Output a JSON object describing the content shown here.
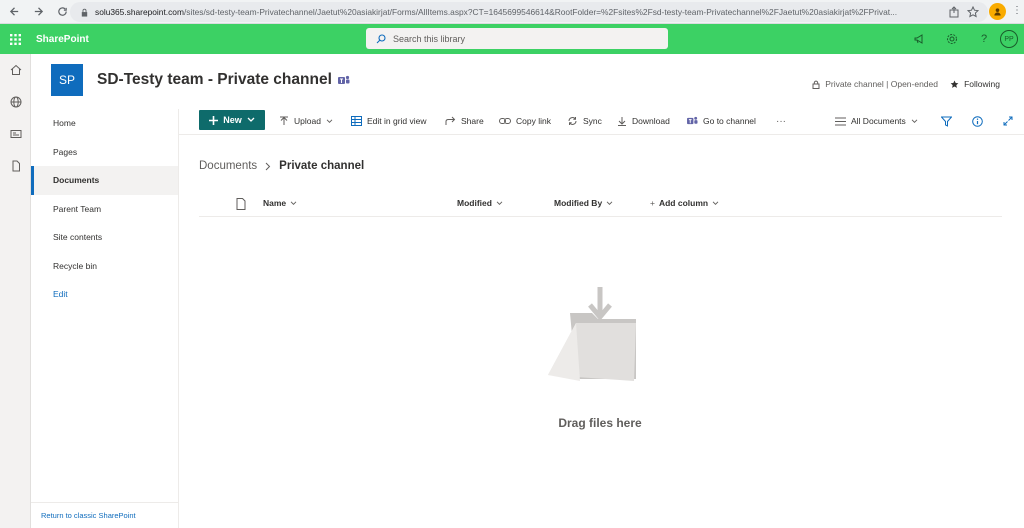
{
  "browser": {
    "url_host": "solu365.sharepoint.com",
    "url_path": "/sites/sd-testy-team-Privatechannel/Jaetut%20asiakirjat/Forms/AllItems.aspx?CT=1645699546614&RootFolder=%2Fsites%2Fsd-testy-team-Privatechannel%2FJaetut%20asiakirjat%2FPrivat..."
  },
  "suite": {
    "brand": "SharePoint",
    "search_placeholder": "Search this library",
    "avatar_initials": "PP",
    "color": "#3cd164"
  },
  "site": {
    "logo": "SP",
    "title": "SD-Testy team - Private channel",
    "meta": "Private channel | Open-ended",
    "following": "Following"
  },
  "nav": {
    "items": [
      "Home",
      "Pages",
      "Documents",
      "Parent Team",
      "Site contents",
      "Recycle bin"
    ],
    "selected": "Documents",
    "edit": "Edit",
    "classic": "Return to classic SharePoint"
  },
  "commands": {
    "new": "New",
    "upload": "Upload",
    "grid": "Edit in grid view",
    "share": "Share",
    "copy_link": "Copy link",
    "sync": "Sync",
    "download": "Download",
    "go_to_channel": "Go to channel",
    "more": "···",
    "view": "All Documents"
  },
  "breadcrumb": {
    "root": "Documents",
    "current": "Private channel"
  },
  "columns": {
    "name": "Name",
    "modified": "Modified",
    "modified_by": "Modified By",
    "add": "Add column"
  },
  "empty": {
    "text": "Drag files here"
  }
}
